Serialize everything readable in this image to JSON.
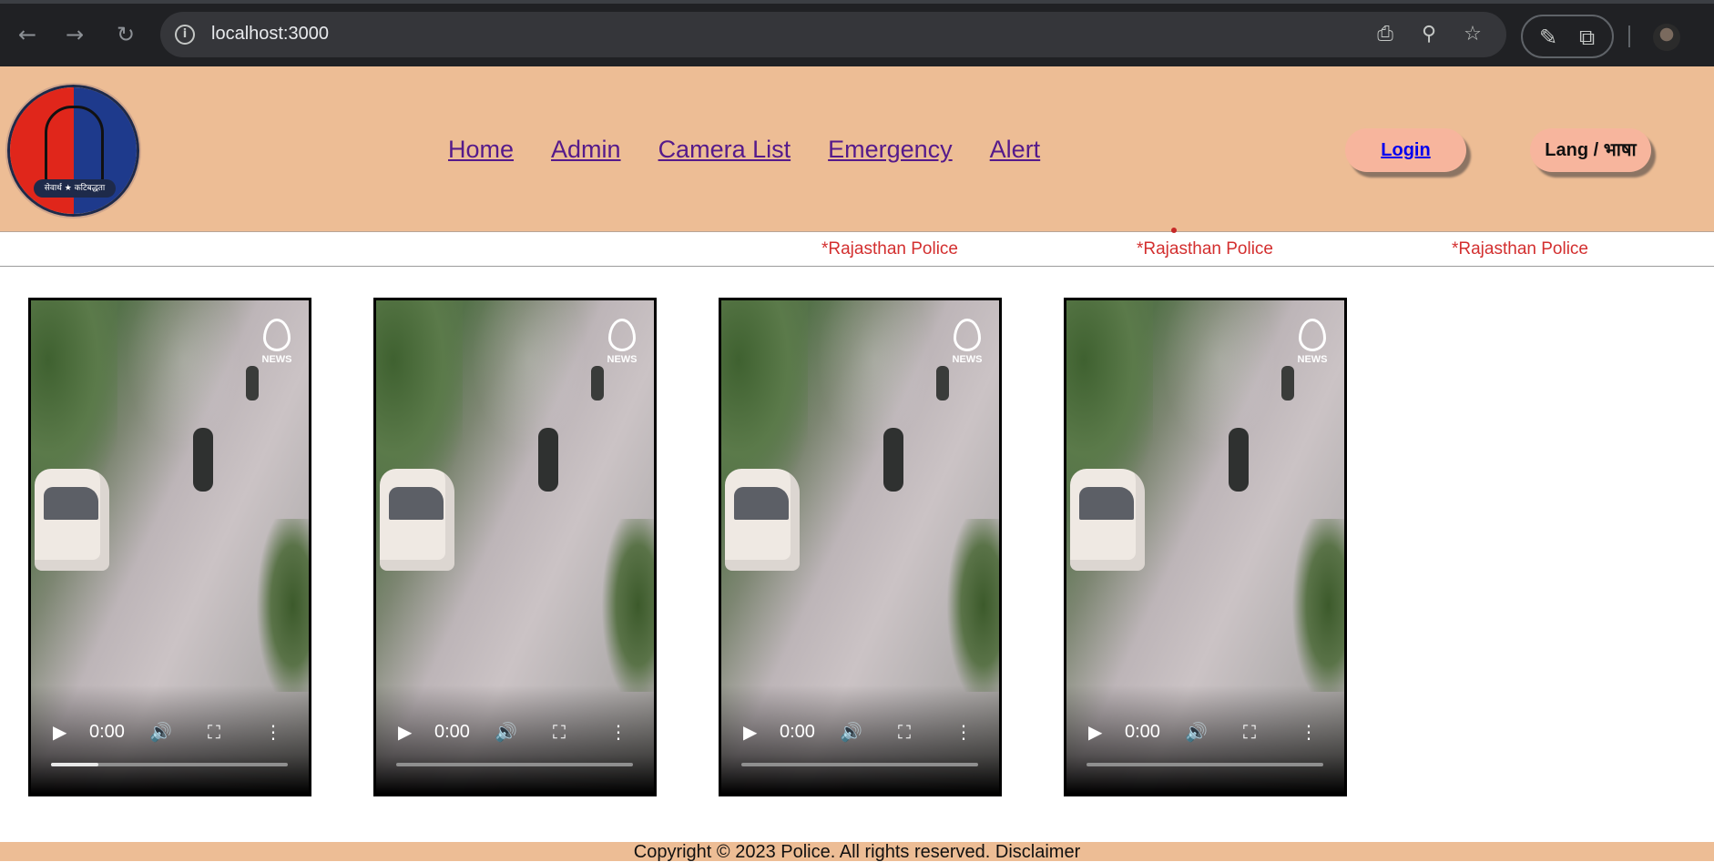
{
  "browser": {
    "url": "localhost:3000",
    "icons": {
      "back": "arrow-left-icon",
      "forward": "arrow-right-icon",
      "reload": "reload-icon",
      "info": "info-icon",
      "install": "install-app-icon",
      "zoom": "zoom-icon",
      "bookmark": "star-icon",
      "eyedropper": "eyedropper-icon",
      "extensions": "puzzle-icon"
    }
  },
  "header": {
    "logo_banner_text": "सेवार्थ ★ कटिबद्धता",
    "nav": [
      {
        "label": "Home"
      },
      {
        "label": "Admin"
      },
      {
        "label": "Camera List"
      },
      {
        "label": "Emergency"
      },
      {
        "label": "Alert"
      }
    ],
    "login_label": "Login",
    "lang_label": "Lang / भाषा"
  },
  "ticker": {
    "items": [
      "*Rajasthan Police",
      "*Rajasthan Police",
      "*Rajasthan Police"
    ]
  },
  "videos": [
    {
      "time": "0:00",
      "watermark": "NEWS",
      "progress": 0.2
    },
    {
      "time": "0:00",
      "watermark": "NEWS",
      "progress": 0
    },
    {
      "time": "0:00",
      "watermark": "NEWS",
      "progress": 0
    },
    {
      "time": "0:00",
      "watermark": "NEWS",
      "progress": 0
    }
  ],
  "footer": {
    "text": "Copyright © 2023 Police. All rights reserved. Disclaimer"
  },
  "colors": {
    "header_bg": "#edbd95",
    "button_bg": "#f7b59d",
    "ticker_text": "#d32f2f",
    "nav_link": "#551a8b"
  }
}
